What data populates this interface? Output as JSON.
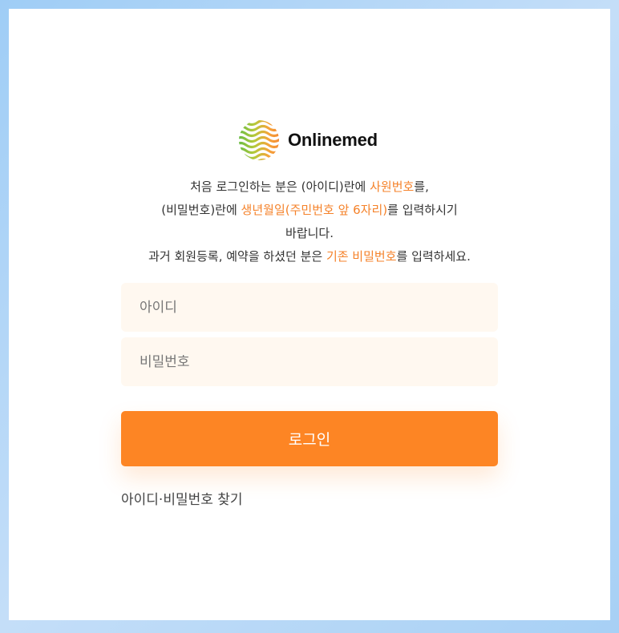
{
  "brand": {
    "name": "Onlinemed",
    "logo_icon": "wavy-globe-icon"
  },
  "notice": {
    "line1_a": "처음 로그인하는 분은 (아이디)란에 ",
    "line1_hl": "사원번호",
    "line1_b": "를,",
    "line2_a": "(비밀번호)란에 ",
    "line2_hl": "생년월일(주민번호 앞 6자리)",
    "line2_b": "를 입력하시기",
    "line3": "바랍니다.",
    "line4_a": "과거 회원등록, 예약을 하셨던 분은 ",
    "line4_hl": "기존 비밀번호",
    "line4_b": "를 입력하세요."
  },
  "form": {
    "id_placeholder": "아이디",
    "pw_placeholder": "비밀번호",
    "login_label": "로그인",
    "find_link": "아이디·비밀번호 찾기"
  },
  "colors": {
    "accent": "#fd8524",
    "highlight": "#f5822a",
    "field_bg": "#fff8f0"
  }
}
